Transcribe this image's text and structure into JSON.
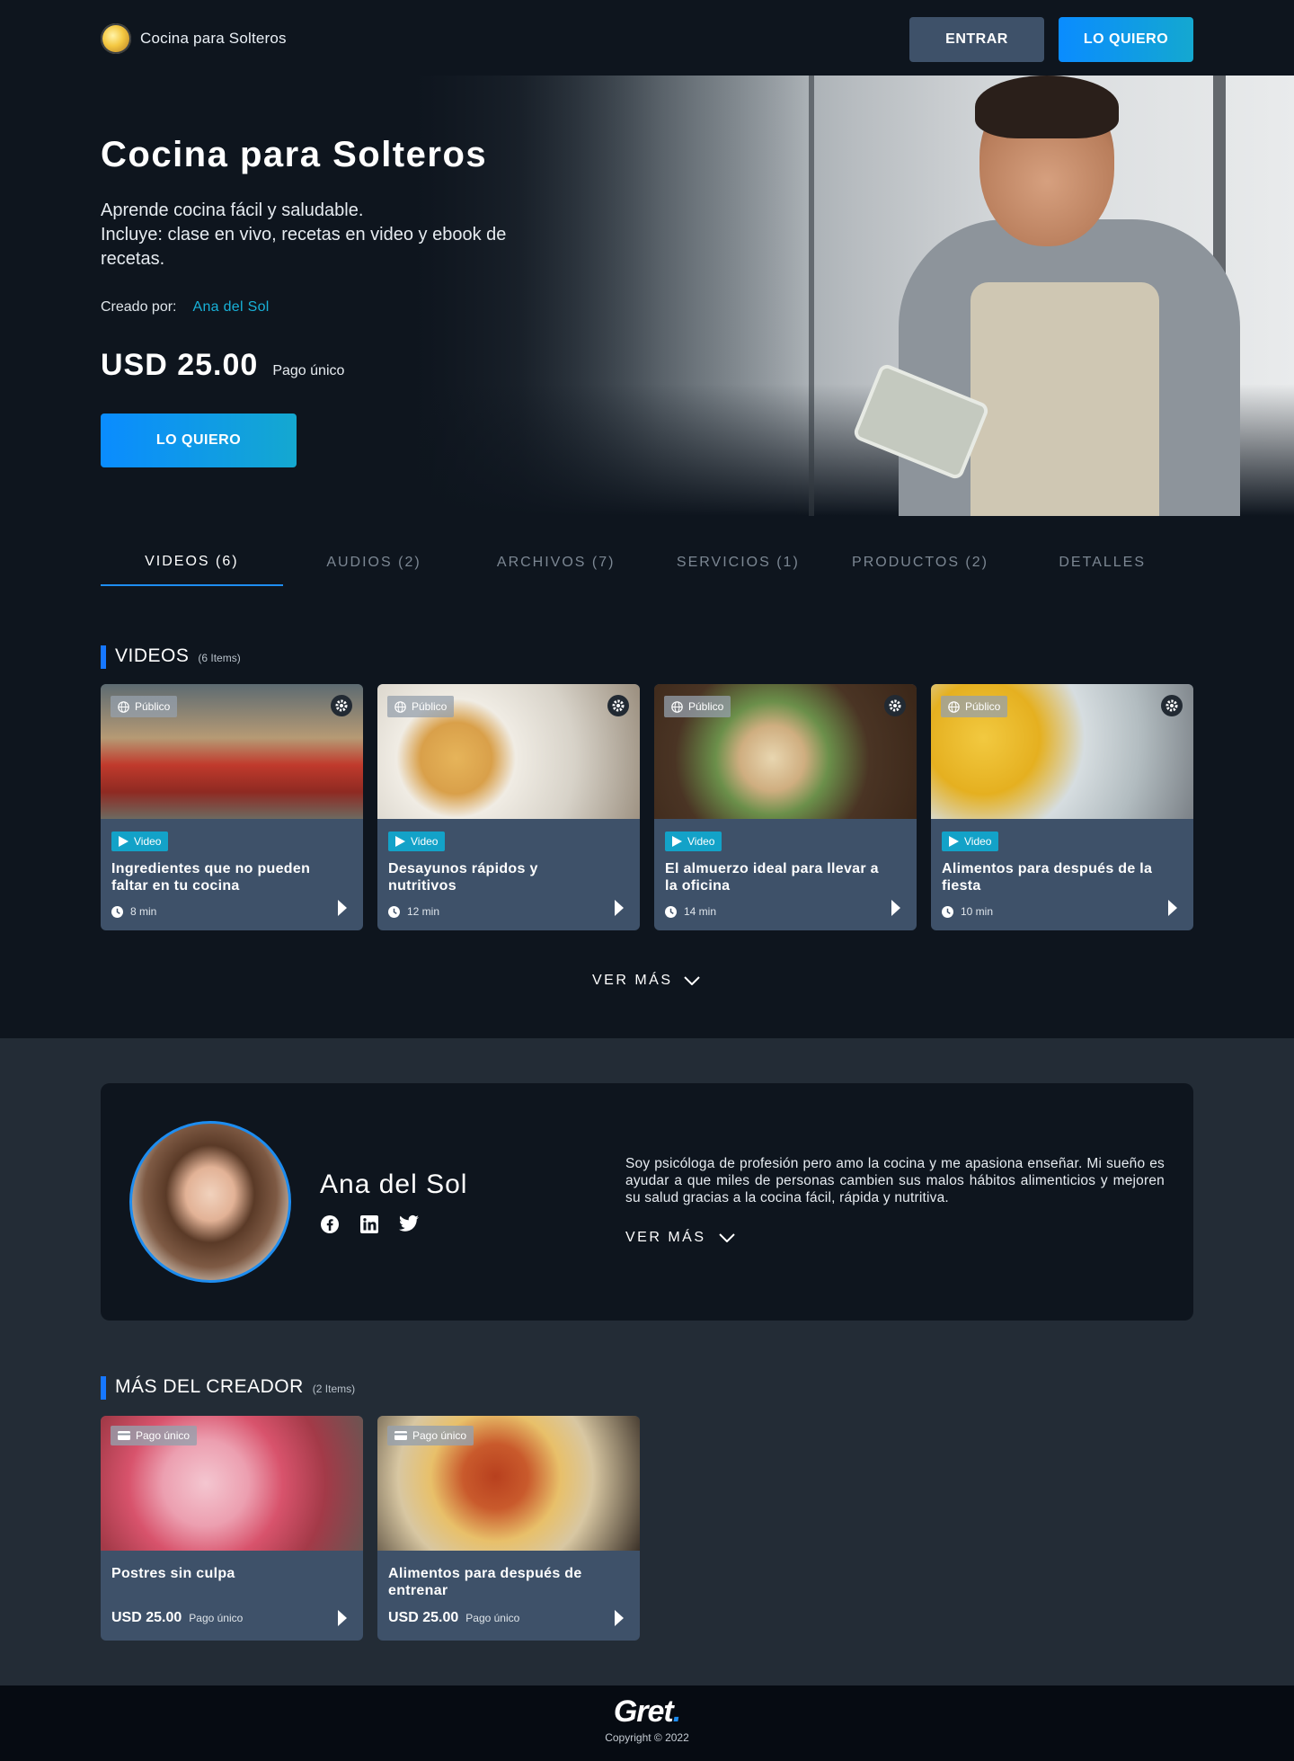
{
  "header": {
    "brand": "Cocina para Solteros",
    "login_label": "ENTRAR",
    "cta_label": "LO QUIERO"
  },
  "hero": {
    "title": "Cocina para Solteros",
    "description": "Aprende cocina fácil y saludable.\nIncluye: clase en vivo, recetas en video y ebook de recetas.",
    "created_by_label": "Creado por:",
    "creator_name": "Ana del Sol",
    "price": "USD 25.00",
    "price_note": "Pago único",
    "cta_label": "LO QUIERO"
  },
  "tabs": [
    {
      "label": "VIDEOS (6)",
      "active": true
    },
    {
      "label": "AUDIOS (2)",
      "active": false
    },
    {
      "label": "ARCHIVOS (7)",
      "active": false
    },
    {
      "label": "SERVICIOS (1)",
      "active": false
    },
    {
      "label": "PRODUCTOS (2)",
      "active": false
    },
    {
      "label": "DETALLES",
      "active": false
    }
  ],
  "videos": {
    "title": "VIDEOS",
    "count": "(6 Items)",
    "items": [
      {
        "visibility": "Público",
        "type": "Video",
        "title": "Ingredientes que no pueden faltar en tu cocina",
        "duration": "8 min"
      },
      {
        "visibility": "Público",
        "type": "Video",
        "title": "Desayunos rápidos y nutritivos",
        "duration": "12 min"
      },
      {
        "visibility": "Público",
        "type": "Video",
        "title": "El almuerzo ideal para llevar a la oficina",
        "duration": "14 min"
      },
      {
        "visibility": "Público",
        "type": "Video",
        "title": "Alimentos para después de la fiesta",
        "duration": "10 min"
      }
    ],
    "more_label": "VER MÁS"
  },
  "creator": {
    "name": "Ana del Sol",
    "bio": "Soy psicóloga de profesión pero amo la cocina y me apasiona enseñar. Mi sueño es ayudar a que miles de personas cambien sus malos hábitos alimenticios y mejoren su salud gracias a la cocina fácil, rápida y nutritiva.",
    "more_label": "VER MÁS",
    "socials": [
      "facebook-icon",
      "linkedin-icon",
      "twitter-icon"
    ]
  },
  "more_from_creator": {
    "title": "MÁS DEL CREADOR",
    "count": "(2 Items)",
    "items": [
      {
        "badge": "Pago único",
        "title": "Postres sin culpa",
        "price": "USD 25.00",
        "price_note": "Pago único"
      },
      {
        "badge": "Pago único",
        "title": "Alimentos para después de entrenar",
        "price": "USD 25.00",
        "price_note": "Pago único"
      }
    ]
  },
  "footer": {
    "logo": "Gret",
    "logo_dot": ".",
    "copyright": "Copyright © 2022"
  },
  "colors": {
    "accent": "#1e8df0",
    "cta_gradient_start": "#0a8cff",
    "cta_gradient_end": "#14a8d0",
    "card_bg": "#3e5169",
    "page_bg": "#0e151e"
  }
}
